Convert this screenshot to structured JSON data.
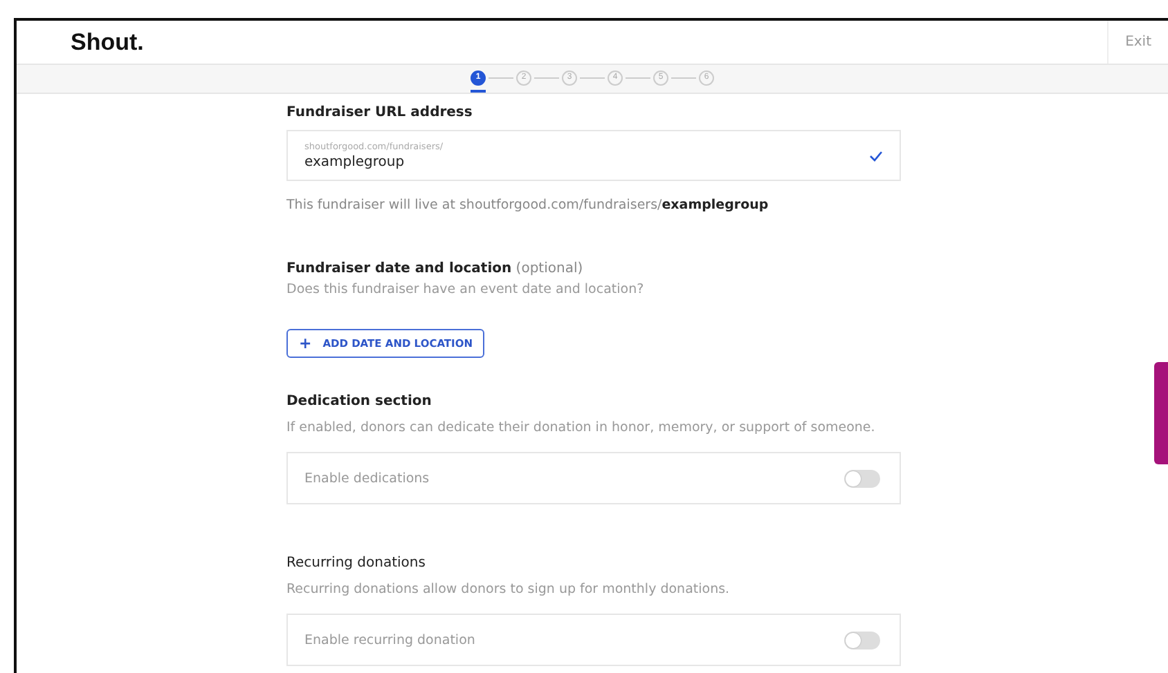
{
  "header": {
    "logo": "Shout.",
    "exit": "Exit"
  },
  "steps": [
    {
      "label": "1",
      "selected": true
    },
    {
      "label": "2",
      "selected": false
    },
    {
      "label": "3",
      "selected": false
    },
    {
      "label": "4",
      "selected": false
    },
    {
      "label": "5",
      "selected": false
    },
    {
      "label": "6",
      "selected": false
    }
  ],
  "url_section": {
    "title": "Fundraiser URL address",
    "field_prefix": "shoutforgood.com/fundraisers/",
    "value": "examplegroup",
    "valid": true,
    "helper": "This fundraiser will live at shoutforgood.com/fundraisers/**examplegroup**"
  },
  "date_section": {
    "title": "**Fundraiser date and location** (optional)",
    "subtitle": "Does this fundraiser have an event date and location?",
    "button_icon": "+",
    "button": "ADD DATE AND LOCATION"
  },
  "toggle_sections": [
    {
      "title": "Dedication section",
      "title_bold": true,
      "subtitle": "If enabled, donors can dedicate their donation in honor, memory, or support of someone.",
      "label": "Enable dedications",
      "on": false
    },
    {
      "title": "Recurring donations",
      "title_bold": false,
      "subtitle": "Recurring donations allow donors to sign up for monthly donations.",
      "label": "Enable recurring donation",
      "on": false
    }
  ],
  "side_tab": {
    "kind": "feedback"
  }
}
